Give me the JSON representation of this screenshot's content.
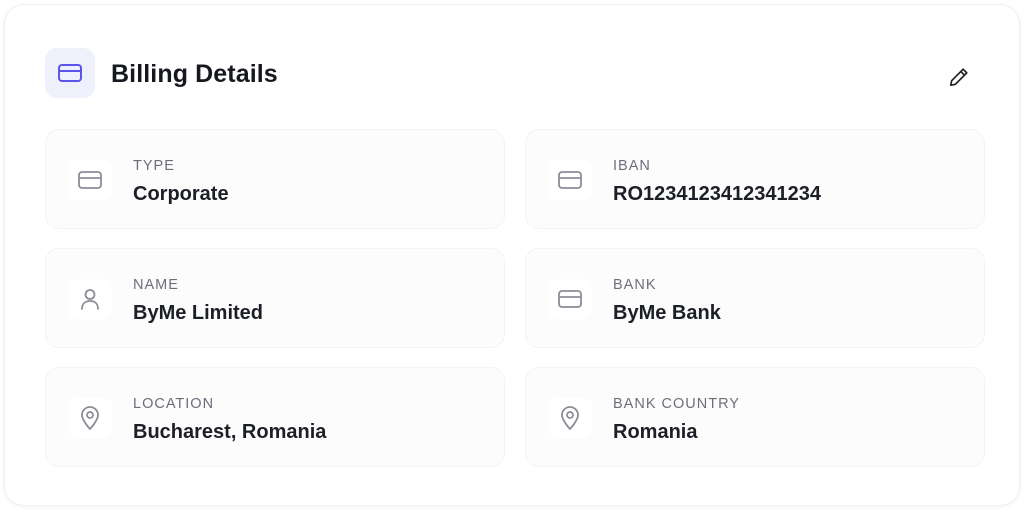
{
  "header": {
    "title": "Billing Details",
    "icon": "credit-card-icon",
    "edit_icon": "pencil-icon",
    "accent": "#5b54e8"
  },
  "fields": [
    {
      "label": "TYPE",
      "value": "Corporate",
      "icon": "credit-card-icon"
    },
    {
      "label": "IBAN",
      "value": "RO1234123412341234",
      "icon": "credit-card-icon"
    },
    {
      "label": "NAME",
      "value": "ByMe Limited",
      "icon": "user-icon"
    },
    {
      "label": "BANK",
      "value": "ByMe Bank",
      "icon": "credit-card-icon"
    },
    {
      "label": "LOCATION",
      "value": "Bucharest, Romania",
      "icon": "map-pin-icon"
    },
    {
      "label": "BANK COUNTRY",
      "value": "Romania",
      "icon": "map-pin-icon"
    }
  ]
}
